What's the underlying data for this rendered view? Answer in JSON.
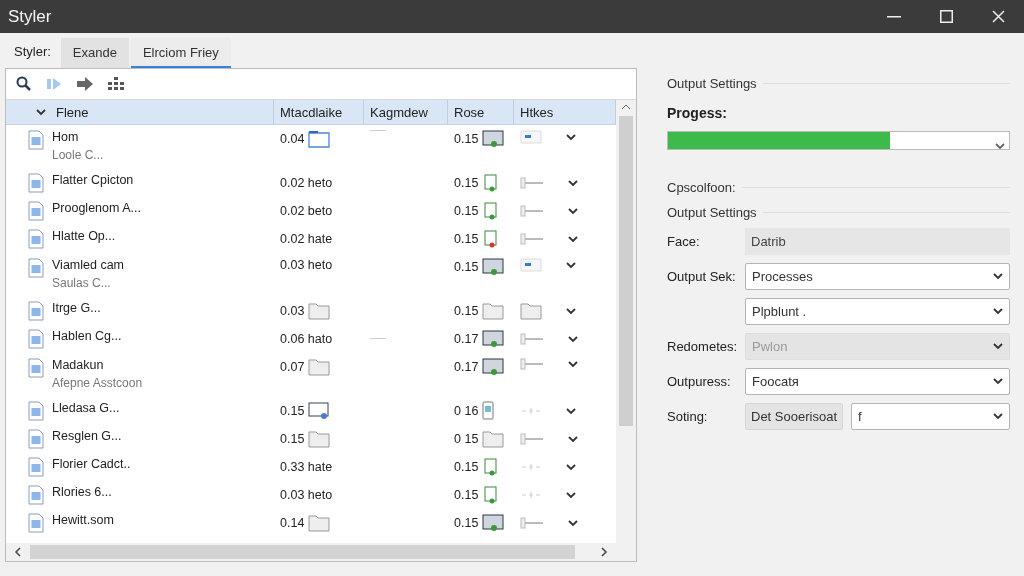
{
  "window": {
    "title": "Styler"
  },
  "tabs_label": "Styler:",
  "tabs": [
    {
      "label": "Exande",
      "selected": false
    },
    {
      "label": "Elrciom Friey",
      "selected": true
    }
  ],
  "table": {
    "columns": [
      "Flene",
      "Mtacdlaike",
      "Kagmdew",
      "Rose",
      "Htkes"
    ],
    "rows": [
      {
        "name": "Hom",
        "sub": "Loole C...",
        "size": "0.04",
        "rose": "0.15"
      },
      {
        "name": "Flatter Cpicton",
        "size": "0.02 heto",
        "rose": "0.15"
      },
      {
        "name": "Prooglenom A...",
        "size": "0.02 beto",
        "rose": "0.15"
      },
      {
        "name": "Hlatte Op...",
        "size": "0.02 hate",
        "rose": "0.15"
      },
      {
        "name": "Viamled cam",
        "sub": "Saulas C...",
        "size": "0.03 heto",
        "rose": "0.15"
      },
      {
        "name": "Itrge G...",
        "size": "0.03",
        "rose": "0.15"
      },
      {
        "name": "Hablen Cg...",
        "size": "0.06 hato",
        "rose": "0.17"
      },
      {
        "name": "Madakun",
        "sub": "Afepne Asstcoon",
        "size": "0.07",
        "rose": "0.17"
      },
      {
        "name": "Lledasa G...",
        "size": "0.15",
        "rose": "0 16"
      },
      {
        "name": "Resglen G...",
        "size": "0.15",
        "rose": "0 15"
      },
      {
        "name": "Florier Cadct..",
        "size": "0.33 hate",
        "rose": "0.15"
      },
      {
        "name": "Rlories 6...",
        "size": "0.03 heto",
        "rose": "0.15"
      },
      {
        "name": "Hewitt.som",
        "size": "0.14",
        "rose": "0.15"
      }
    ]
  },
  "settings": {
    "heading": "Output Settings",
    "progress_label": "Progess:",
    "progress": {
      "level": 0.65
    },
    "section_1": "Cpscolfoon:",
    "section_2": "Output Settings",
    "fields": [
      {
        "kind": "text",
        "label": "Face:",
        "value": "Datrib"
      },
      {
        "kind": "select",
        "label": "Output Sek:",
        "value": "Processes",
        "disabled": false
      },
      {
        "kind": "select",
        "value": "Plpblunt .",
        "disabled": false
      },
      {
        "kind": "select",
        "label": "Redometes:",
        "value": "Pwlon",
        "disabled": true
      },
      {
        "kind": "select",
        "label": "Outpuress:",
        "value": "Foocatя",
        "disabled": false
      },
      {
        "kind": "button-select",
        "label": "Soting:",
        "button": "Det Sooerisoat",
        "value": "f"
      }
    ]
  }
}
